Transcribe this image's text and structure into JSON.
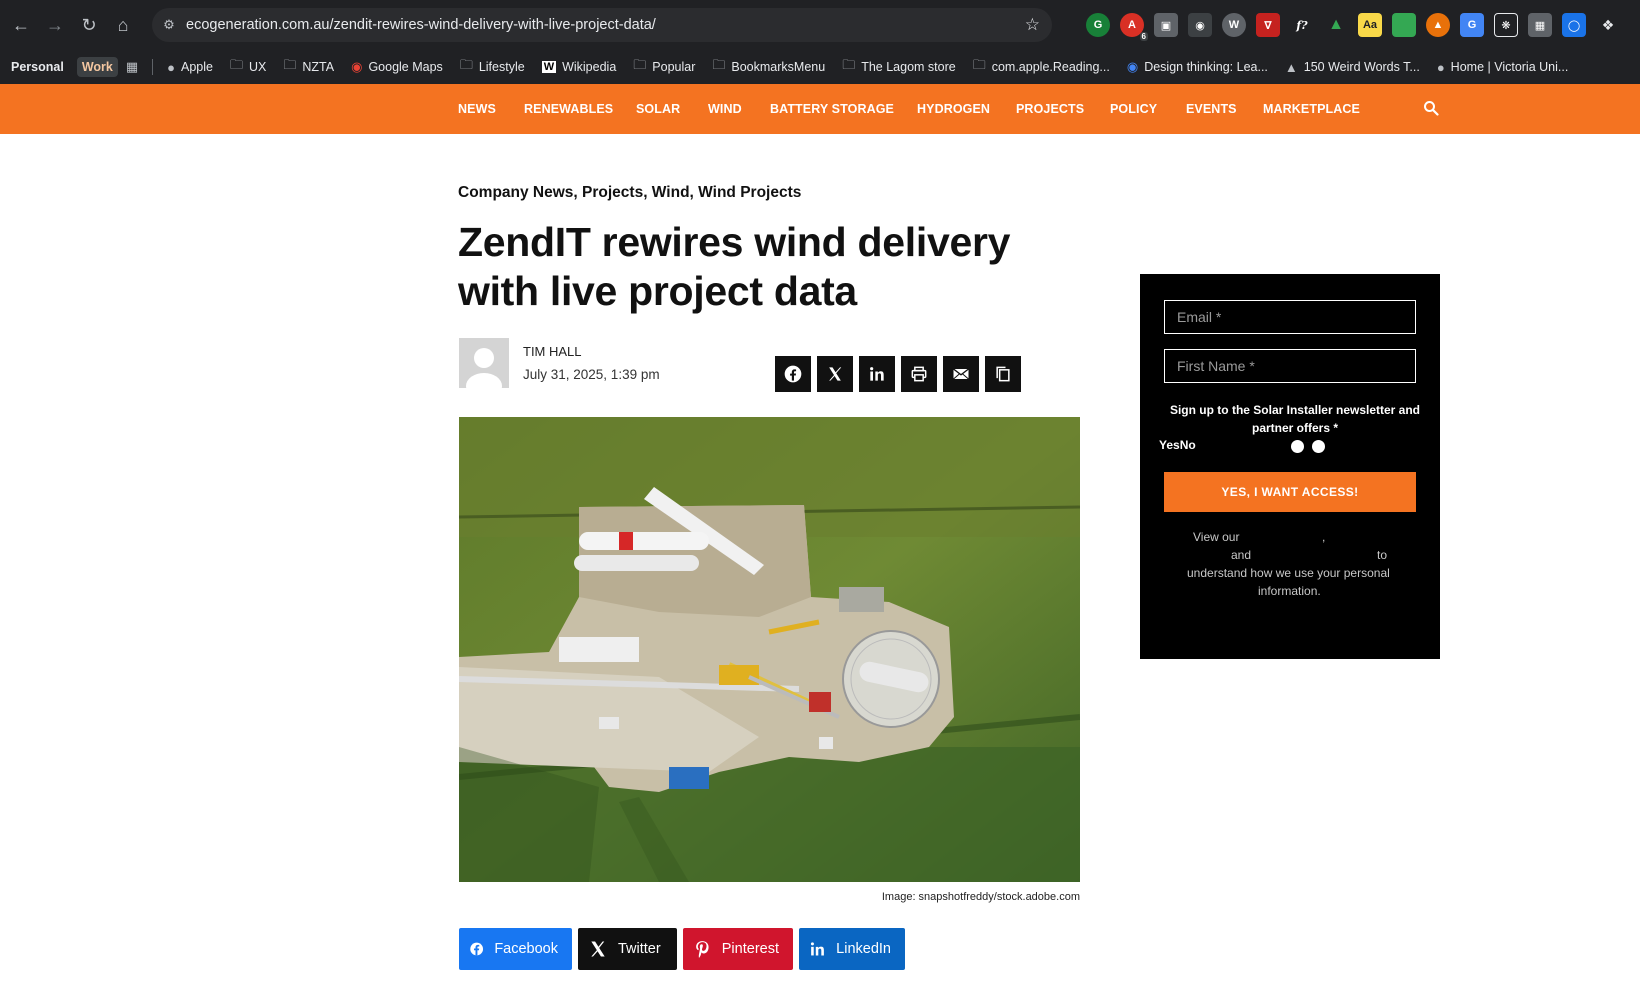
{
  "browser": {
    "url": "ecogeneration.com.au/zendit-rewires-wind-delivery-with-live-project-data/",
    "profiles": [
      "Personal",
      "Work"
    ],
    "bookmarks": [
      "Apple",
      "UX",
      "NZTA",
      "Google Maps",
      "Lifestyle",
      "Wikipedia",
      "Popular",
      "BookmarksMenu",
      "The Lagom store",
      "com.apple.Reading...",
      "Design thinking: Lea...",
      "150 Weird Words T...",
      "Home | Victoria Uni..."
    ],
    "extension_badge": "6"
  },
  "nav": {
    "items": [
      "NEWS",
      "RENEWABLES",
      "SOLAR",
      "WIND",
      "BATTERY STORAGE",
      "HYDROGEN",
      "PROJECTS",
      "POLICY",
      "EVENTS",
      "MARKETPLACE"
    ],
    "brand_color": "#f47321"
  },
  "article": {
    "categories": "Company News, Projects, Wind, Wind Projects",
    "title": "ZendIT rewires wind delivery with live project data",
    "author": "TIM HALL",
    "date": "July 31, 2025, 1:39 pm",
    "image_caption": "Image: snapshotfreddy/stock.adobe.com"
  },
  "social": {
    "facebook": "Facebook",
    "twitter": "Twitter",
    "pinterest": "Pinterest",
    "linkedin": "LinkedIn"
  },
  "newsletter": {
    "email_placeholder": "Email *",
    "firstname_placeholder": "First Name *",
    "signup_label": "Sign up to the Solar Installer newsletter and partner offers *",
    "yes_no": "YesNo",
    "submit": "YES, I WANT ACCESS!",
    "view_our": "View our",
    "comma": ",",
    "and": "and",
    "to": "to",
    "understand": "understand how we use your personal",
    "information": "information."
  }
}
